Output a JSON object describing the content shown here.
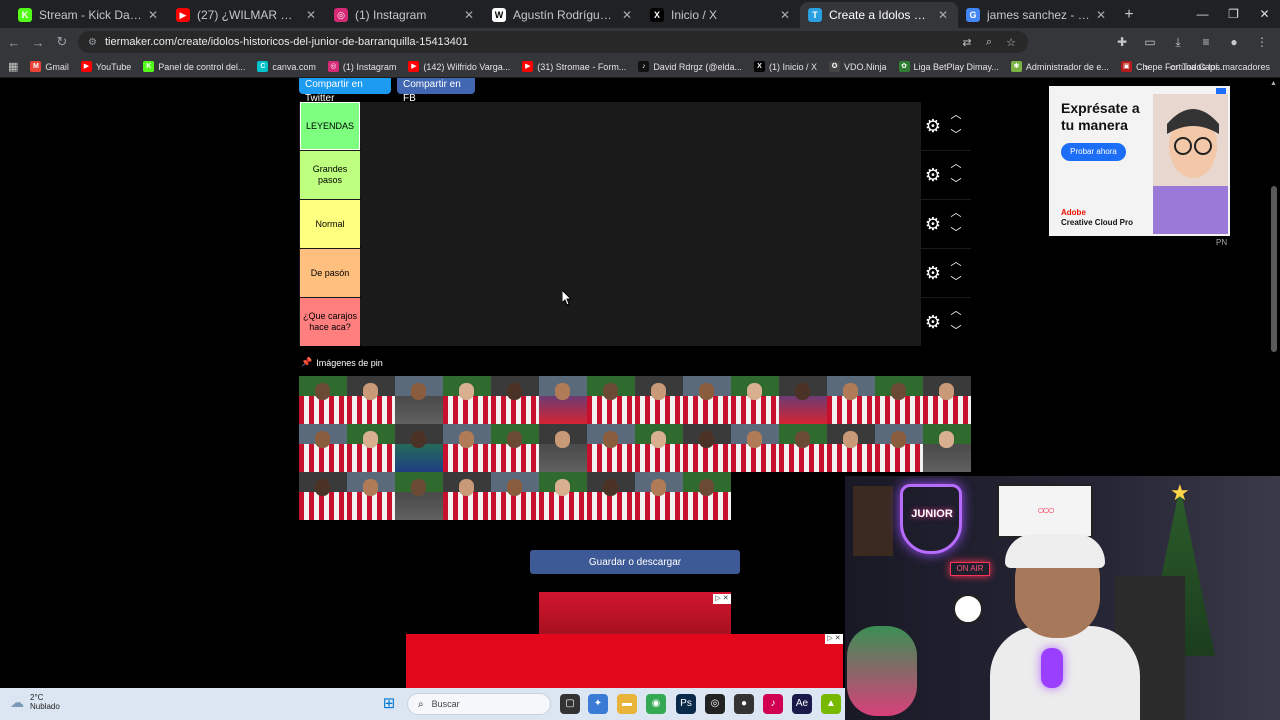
{
  "browser": {
    "tabs": [
      {
        "title": "Stream - Kick Dashboard",
        "favicon": "kick-icon",
        "color": "#53fc18",
        "glyph": "K",
        "active": false
      },
      {
        "title": "(27) ¿WILMAR BARRIOS Y A",
        "favicon": "youtube-icon",
        "color": "#ff0000",
        "glyph": "▶",
        "active": false
      },
      {
        "title": "(1) Instagram",
        "favicon": "instagram-icon",
        "color": "#d62976",
        "glyph": "◎",
        "active": false
      },
      {
        "title": "Agustín Rodríguez Rosano - W",
        "favicon": "wikipedia-icon",
        "color": "#ffffff",
        "glyph": "W",
        "active": false
      },
      {
        "title": "Inicio / X",
        "favicon": "x-icon",
        "color": "#000000",
        "glyph": "X",
        "active": false
      },
      {
        "title": "Create a Idolos historicos del ju",
        "favicon": "tiermaker-icon",
        "color": "#2aa0e0",
        "glyph": "T",
        "active": true
      },
      {
        "title": "james sanchez - Buscar con Go",
        "favicon": "google-icon",
        "color": "#4285f4",
        "glyph": "G",
        "active": false
      }
    ],
    "url": "tiermaker.com/create/idolos-historicos-del-junior-de-barranquilla-15413401",
    "bookmarks": [
      {
        "label": "Gmail",
        "icon": "gmail-icon",
        "color": "#ea4335",
        "glyph": "M"
      },
      {
        "label": "YouTube",
        "icon": "youtube-icon",
        "color": "#ff0000",
        "glyph": "▶"
      },
      {
        "label": "Panel de control del...",
        "icon": "kick-icon",
        "color": "#53fc18",
        "glyph": "K"
      },
      {
        "label": "canva.com",
        "icon": "canva-icon",
        "color": "#00c4cc",
        "glyph": "C"
      },
      {
        "label": "(1) Instagram",
        "icon": "instagram-icon",
        "color": "#d62976",
        "glyph": "◎"
      },
      {
        "label": "(142) Wilfrido Varga...",
        "icon": "youtube-icon",
        "color": "#ff0000",
        "glyph": "▶"
      },
      {
        "label": "(31) Stromae - Form...",
        "icon": "youtube-icon",
        "color": "#ff0000",
        "glyph": "▶"
      },
      {
        "label": "David Rdrgz (@elda...",
        "icon": "tiktok-icon",
        "color": "#111111",
        "glyph": "♪"
      },
      {
        "label": "(1) Inicio / X",
        "icon": "x-icon",
        "color": "#000000",
        "glyph": "X"
      },
      {
        "label": "VDO.Ninja",
        "icon": "vdo-ninja-icon",
        "color": "#444444",
        "glyph": "✪"
      },
      {
        "label": "Liga BetPlay Dimay...",
        "icon": "betplay-icon",
        "color": "#2e7d32",
        "glyph": "✿"
      },
      {
        "label": "Administrador de e...",
        "icon": "admin-icon",
        "color": "#7cb342",
        "glyph": "✱"
      },
      {
        "label": "Chepe Fortuna Capí...",
        "icon": "page-icon",
        "color": "#b71c1c",
        "glyph": "▣"
      }
    ],
    "all_bookmarks": "Todos los marcadores"
  },
  "page": {
    "share_twitter": "Compartir en Twitter",
    "share_fb": "Compartir en FB",
    "tiers": [
      {
        "label": "LEYENDAS",
        "color": "#7fff7f",
        "selected": true
      },
      {
        "label": "Grandes pasos",
        "color": "#bfff7f",
        "selected": false
      },
      {
        "label": "Normal",
        "color": "#ffff7f",
        "selected": false
      },
      {
        "label": "De pasón",
        "color": "#ffbf7f",
        "selected": false
      },
      {
        "label": "¿Que carajos hace aca?",
        "color": "#ff7f7f",
        "selected": false
      }
    ],
    "pool_title": "Imágenes de pin",
    "pool_count": 37,
    "save_button": "Guardar o descargar",
    "ad": {
      "headline": "Exprésate a tu manera",
      "cta": "Probar ahora",
      "brand_top": "Adobe",
      "brand_bottom": "Creative Cloud Pro",
      "tag": "PN"
    }
  },
  "webcam": {
    "logo": "JUNIOR",
    "onair": "ON AIR"
  },
  "taskbar": {
    "temp": "2°C",
    "weather": "Nublado",
    "search": "Buscar"
  }
}
